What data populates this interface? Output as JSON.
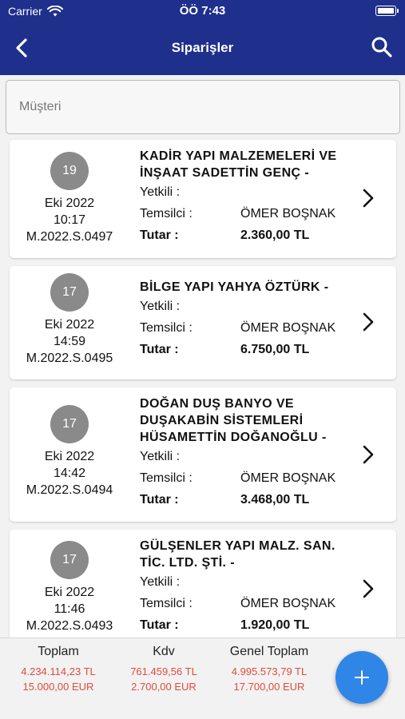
{
  "status_bar": {
    "carrier": "Carrier",
    "time": "ÖÖ 7:43"
  },
  "header": {
    "title": "Siparişler"
  },
  "search": {
    "placeholder": "Müşteri",
    "value": ""
  },
  "labels": {
    "yetkili": "Yetkili :",
    "temsilci": "Temsilci :",
    "tutar": "Tutar :"
  },
  "orders": [
    {
      "day": "19",
      "month_year": "Eki 2022",
      "time": "10:17",
      "code": "M.2022.S.0497",
      "company": "KADİR YAPI MALZEMELERİ VE İNŞAAT SADETTİN GENÇ -",
      "yetkili": "",
      "temsilci": "ÖMER BOŞNAK",
      "tutar": "2.360,00 TL"
    },
    {
      "day": "17",
      "month_year": "Eki 2022",
      "time": "14:59",
      "code": "M.2022.S.0495",
      "company": "BİLGE YAPI YAHYA ÖZTÜRK -",
      "yetkili": "",
      "temsilci": "ÖMER BOŞNAK",
      "tutar": "6.750,00 TL"
    },
    {
      "day": "17",
      "month_year": "Eki 2022",
      "time": "14:42",
      "code": "M.2022.S.0494",
      "company": "DOĞAN DUŞ BANYO VE DUŞAKABİN SİSTEMLERİ HÜSAMETTİN DOĞANOĞLU -",
      "yetkili": "",
      "temsilci": "ÖMER BOŞNAK",
      "tutar": "3.468,00 TL"
    },
    {
      "day": "17",
      "month_year": "Eki 2022",
      "time": "11:46",
      "code": "M.2022.S.0493",
      "company": "GÜLŞENLER YAPI MALZ. SAN. TİC. LTD. ŞTİ. -",
      "yetkili": "",
      "temsilci": "ÖMER BOŞNAK",
      "tutar": "1.920,00 TL"
    }
  ],
  "footer": {
    "toplam": {
      "label": "Toplam",
      "tl": "4.234.114,23 TL",
      "eur": "15.000,00 EUR"
    },
    "kdv": {
      "label": "Kdv",
      "tl": "761.459,56 TL",
      "eur": "2.700,00 EUR"
    },
    "genel_toplam": {
      "label": "Genel Toplam",
      "tl": "4.995.573,79 TL",
      "eur": "17.700,00 EUR"
    }
  },
  "colors": {
    "header_bg": "#1f2f8c",
    "amount_red": "#e24a3b",
    "fab_blue": "#2f86e6",
    "badge_grey": "#8a8a8a"
  },
  "icons": [
    "wifi-icon",
    "battery-icon",
    "back-chevron-icon",
    "search-icon",
    "chevron-right-icon",
    "plus-icon"
  ]
}
